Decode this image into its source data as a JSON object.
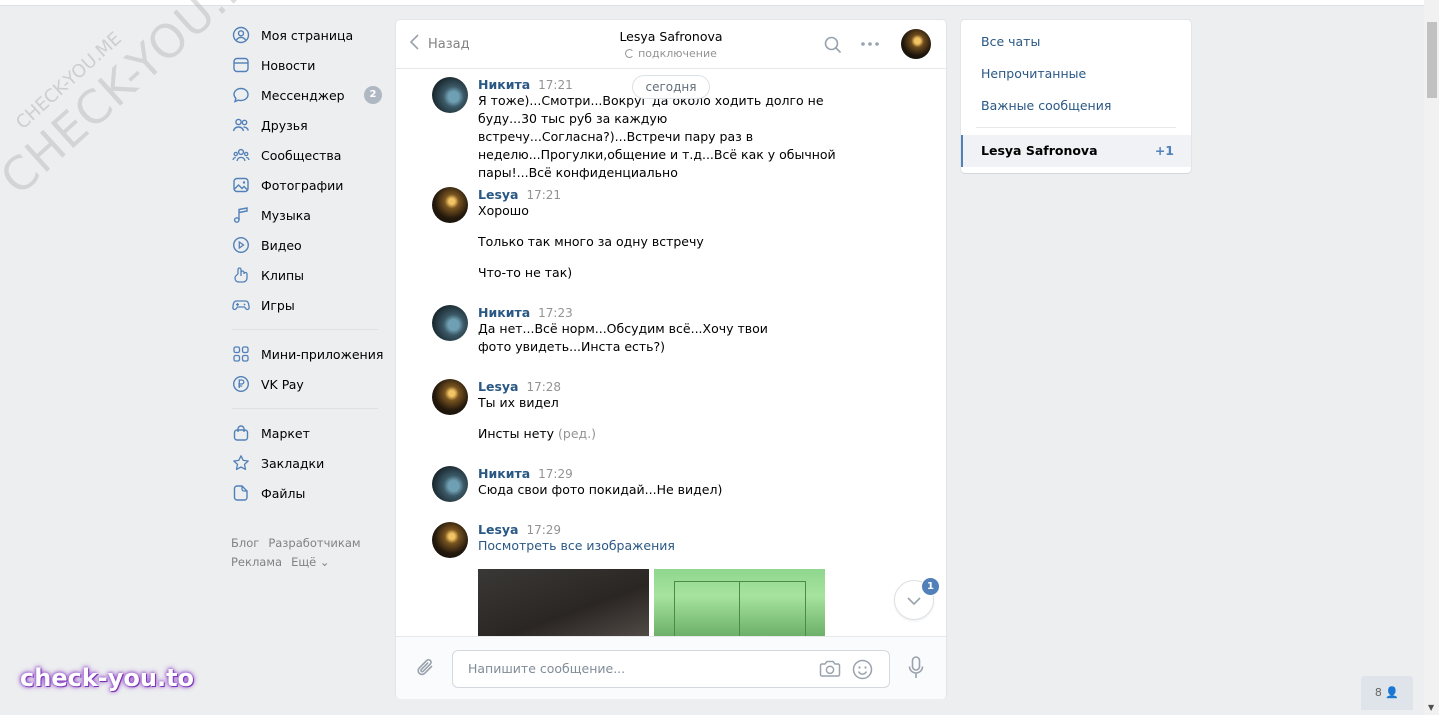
{
  "nav": {
    "items": [
      {
        "label": "Моя страница"
      },
      {
        "label": "Новости"
      },
      {
        "label": "Мессенджер",
        "count": "2"
      },
      {
        "label": "Друзья"
      },
      {
        "label": "Сообщества"
      },
      {
        "label": "Фотографии"
      },
      {
        "label": "Музыка"
      },
      {
        "label": "Видео"
      },
      {
        "label": "Клипы"
      },
      {
        "label": "Игры"
      }
    ],
    "items2": [
      {
        "label": "Мини-приложения"
      },
      {
        "label": "VK Pay"
      }
    ],
    "items3": [
      {
        "label": "Маркет"
      },
      {
        "label": "Закладки"
      },
      {
        "label": "Файлы"
      }
    ],
    "footer": [
      "Блог",
      "Разработчикам",
      "Реклама",
      "Ещё ⌄"
    ]
  },
  "chat": {
    "back_label": "Назад",
    "title": "Lesya Safronova",
    "status": "подключение",
    "date_pill": "сегодня",
    "messages": [
      {
        "author": "Никита",
        "time": "17:21",
        "texts": [
          "Я тоже)...Смотри...Вокруг да около ходить долго не буду...30 тыс руб за каждую встречу...Согласна?)...Встречи пару раз в неделю...Прогулки,общение и т.д...Всё как у обычной пары!...Всё конфиденциально"
        ]
      },
      {
        "author": "Lesya",
        "time": "17:21",
        "texts": [
          "Хорошо",
          "Только так много за одну встречу",
          "Что-то не так)"
        ]
      },
      {
        "author": "Никита",
        "time": "17:23",
        "texts": [
          "Да нет...Всё норм...Обсудим всё...Хочу твои фото увидеть...Инста есть?)"
        ]
      },
      {
        "author": "Lesya",
        "time": "17:28",
        "texts": [
          "Ты их видел",
          "Инсты нету"
        ],
        "edited": "(ред.)"
      },
      {
        "author": "Никита",
        "time": "17:29",
        "texts": [
          "Сюда свои фото покидай...Не видел)"
        ]
      },
      {
        "author": "Lesya",
        "time": "17:29",
        "link": "Посмотреть все изображения"
      }
    ],
    "scroll_badge": "1",
    "composer_placeholder": "Напишите сообщение..."
  },
  "right_menu": {
    "items": [
      "Все чаты",
      "Непрочитанные",
      "Важные сообщения"
    ],
    "active": {
      "label": "Lesya Safronova",
      "count": "+1"
    }
  },
  "watermark": {
    "big": "CHECK-YOU.ME",
    "small": "CHECK-YOU.ME",
    "logo": "check-you.to"
  },
  "online_widget": "8 👤"
}
